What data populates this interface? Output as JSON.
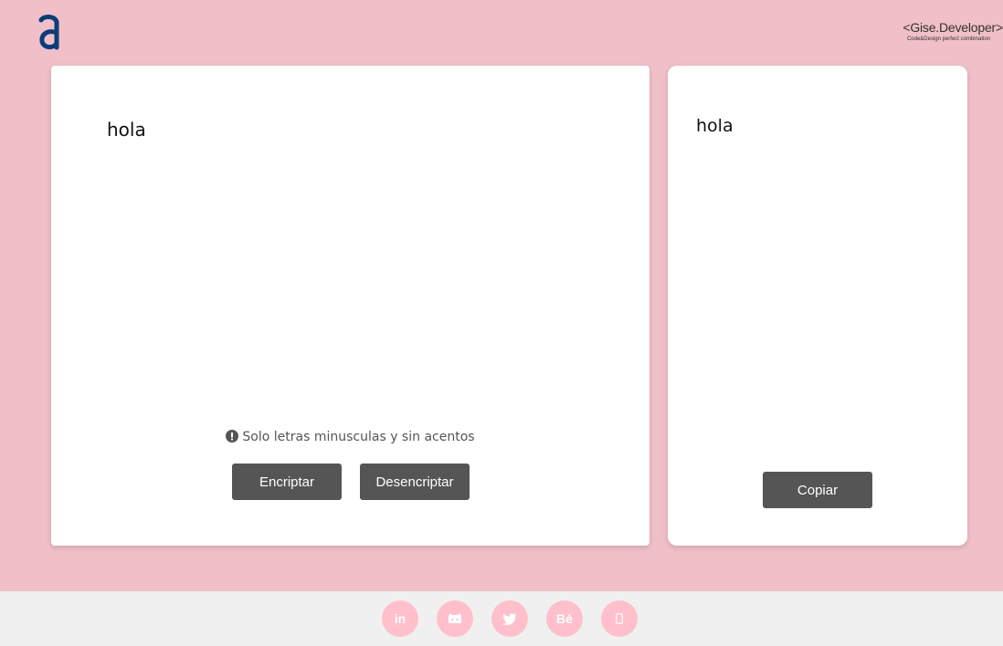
{
  "header": {
    "brand_name": "<Gise.Developer>",
    "brand_tagline": "Code&Design perfect combination"
  },
  "encryptor": {
    "input_text": "hola",
    "hint": "Solo letras minusculas y sin acentos",
    "encrypt_label": "Encriptar",
    "decrypt_label": "Desencriptar"
  },
  "output": {
    "result_text": "hola",
    "copy_label": "Copiar"
  },
  "footer": {
    "social": [
      {
        "icon": "linkedin-icon",
        "glyph": "in"
      },
      {
        "icon": "github-icon",
        "glyph": ""
      },
      {
        "icon": "twitter-icon",
        "glyph": ""
      },
      {
        "icon": "behance-icon",
        "glyph": "Bé"
      },
      {
        "icon": "phone-icon",
        "glyph": ""
      }
    ]
  },
  "colors": {
    "background": "#f0bfc8",
    "button": "#555555",
    "logo": "#0a3d7a",
    "social": "#ffc0cb",
    "footer": "#f0f0f0"
  }
}
